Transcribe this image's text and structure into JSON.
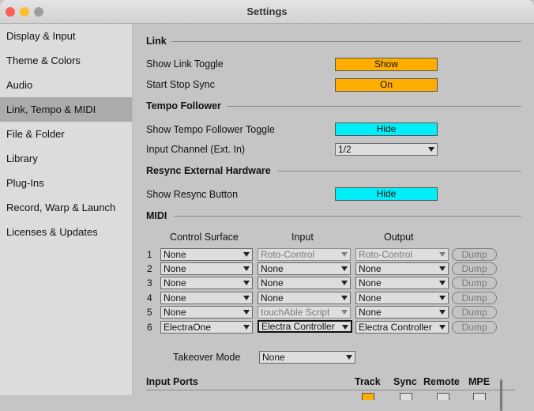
{
  "window": {
    "title": "Settings"
  },
  "sidebar": {
    "items": [
      {
        "label": "Display & Input"
      },
      {
        "label": "Theme & Colors"
      },
      {
        "label": "Audio"
      },
      {
        "label": "Link, Tempo & MIDI",
        "selected": true
      },
      {
        "label": "File & Folder"
      },
      {
        "label": "Library"
      },
      {
        "label": "Plug-Ins"
      },
      {
        "label": "Record, Warp & Launch"
      },
      {
        "label": "Licenses & Updates"
      }
    ]
  },
  "link": {
    "header": "Link",
    "show_toggle": {
      "label": "Show Link Toggle",
      "value": "Show"
    },
    "start_stop_sync": {
      "label": "Start Stop Sync",
      "value": "On"
    }
  },
  "tempo_follower": {
    "header": "Tempo Follower",
    "show_toggle": {
      "label": "Show Tempo Follower Toggle",
      "value": "Hide"
    },
    "input_channel": {
      "label": "Input Channel (Ext. In)",
      "value": "1/2"
    }
  },
  "resync": {
    "header": "Resync External Hardware",
    "show_button": {
      "label": "Show Resync Button",
      "value": "Hide"
    }
  },
  "midi": {
    "header": "MIDI",
    "columns": {
      "control_surface": "Control Surface",
      "input": "Input",
      "output": "Output"
    },
    "dump_label": "Dump",
    "rows": [
      {
        "num": "1",
        "surface": "None",
        "input": "Roto-Control",
        "output": "Roto-Control"
      },
      {
        "num": "2",
        "surface": "None",
        "input": "None",
        "output": "None"
      },
      {
        "num": "3",
        "surface": "None",
        "input": "None",
        "output": "None"
      },
      {
        "num": "4",
        "surface": "None",
        "input": "None",
        "output": "None"
      },
      {
        "num": "5",
        "surface": "None",
        "input": "touchAble Script",
        "output": "None"
      },
      {
        "num": "6",
        "surface": "ElectraOne",
        "input": "Electra Controller",
        "output": "Electra Controller"
      }
    ],
    "takeover": {
      "label": "Takeover Mode",
      "value": "None"
    }
  },
  "input_ports": {
    "header": "Input Ports",
    "columns": {
      "track": "Track",
      "sync": "Sync",
      "remote": "Remote",
      "mpe": "MPE"
    }
  },
  "colors": {
    "accent_orange": "#ffae00",
    "accent_cyan": "#00eef8",
    "selected_row": "#ababab"
  }
}
